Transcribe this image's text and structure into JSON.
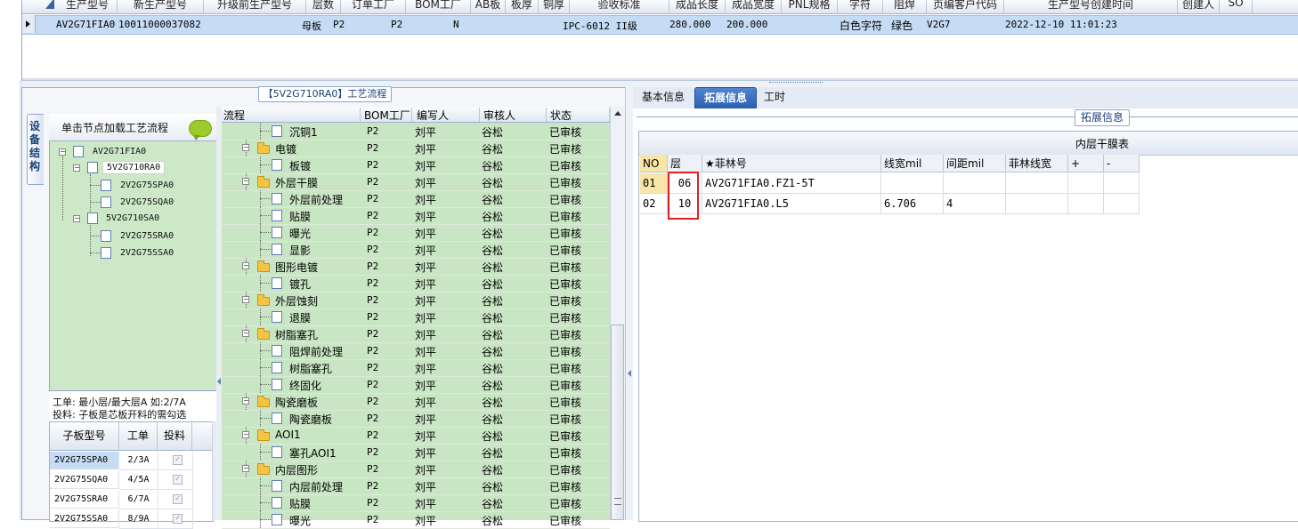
{
  "top_grid": {
    "headers": [
      "生产型号",
      "新生产型号",
      "升级前生产型号",
      "层数",
      "订单工厂",
      "BOM工厂",
      "AB板",
      "板厚",
      "铜厚",
      "验收标准",
      "成品长度",
      "成品宽度",
      "PNL规格",
      "字符",
      "阻焊",
      "页编客户代码",
      "生产型号创建时间",
      "创建人",
      "SO"
    ],
    "row": {
      "model": "AV2G71FIA0",
      "new_model": "10011000037082",
      "board_type": "母板",
      "order_factory": "P2",
      "bom_factory": "P2",
      "ab": "N",
      "standard": "IPC-6012 II级",
      "length": "280.000",
      "width": "200.000",
      "char": "白色字符",
      "solder": "绿色",
      "code": "V2G7",
      "created": "2022-12-10 11:01:23"
    }
  },
  "left_panel": {
    "title": "【5V2G710RA0】工艺流程",
    "vertical_tab": "设备结构",
    "tree_header": "单击节点加载工艺流程",
    "tree": [
      {
        "label": "AV2G71FIA0",
        "level": 0
      },
      {
        "label": "5V2G710RA0",
        "level": 1
      },
      {
        "label": "2V2G75SPA0",
        "level": 2
      },
      {
        "label": "2V2G75SQA0",
        "level": 2
      },
      {
        "label": "5V2G710SA0",
        "level": 1
      },
      {
        "label": "2V2G75SRA0",
        "level": 2
      },
      {
        "label": "2V2G75SSA0",
        "level": 2
      }
    ],
    "note_line1": "工单: 最小层/最大层A 如:2/7A",
    "note_line2": "投料: 子板是芯板开料的需勾选",
    "subgrid_headers": [
      "子板型号",
      "工单",
      "投料"
    ],
    "subgrid_rows": [
      {
        "model": "2V2G75SPA0",
        "order": "2/3A"
      },
      {
        "model": "2V2G75SQA0",
        "order": "4/5A"
      },
      {
        "model": "2V2G75SRA0",
        "order": "6/7A"
      },
      {
        "model": "2V2G75SSA0",
        "order": "8/9A"
      }
    ]
  },
  "flow_grid": {
    "headers": [
      "流程",
      "BOM工厂",
      "编写人",
      "审核人",
      "状态"
    ],
    "rows": [
      {
        "name": "沉铜1",
        "type": "doc",
        "factory": "P2",
        "writer": "刘平",
        "reviewer": "谷松",
        "status": "已审核"
      },
      {
        "name": "电镀",
        "type": "folder",
        "factory": "P2",
        "writer": "刘平",
        "reviewer": "谷松",
        "status": "已审核"
      },
      {
        "name": "板镀",
        "type": "doc",
        "factory": "P2",
        "writer": "刘平",
        "reviewer": "谷松",
        "status": "已审核"
      },
      {
        "name": "外层干膜",
        "type": "folder",
        "factory": "P2",
        "writer": "刘平",
        "reviewer": "谷松",
        "status": "已审核"
      },
      {
        "name": "外层前处理",
        "type": "doc",
        "factory": "P2",
        "writer": "刘平",
        "reviewer": "谷松",
        "status": "已审核"
      },
      {
        "name": "贴膜",
        "type": "doc",
        "factory": "P2",
        "writer": "刘平",
        "reviewer": "谷松",
        "status": "已审核"
      },
      {
        "name": "曝光",
        "type": "doc",
        "factory": "P2",
        "writer": "刘平",
        "reviewer": "谷松",
        "status": "已审核"
      },
      {
        "name": "显影",
        "type": "doc",
        "factory": "P2",
        "writer": "刘平",
        "reviewer": "谷松",
        "status": "已审核"
      },
      {
        "name": "图形电镀",
        "type": "folder",
        "factory": "P2",
        "writer": "刘平",
        "reviewer": "谷松",
        "status": "已审核"
      },
      {
        "name": "镀孔",
        "type": "doc",
        "factory": "P2",
        "writer": "刘平",
        "reviewer": "谷松",
        "status": "已审核"
      },
      {
        "name": "外层蚀刻",
        "type": "folder",
        "factory": "P2",
        "writer": "刘平",
        "reviewer": "谷松",
        "status": "已审核"
      },
      {
        "name": "退膜",
        "type": "doc",
        "factory": "P2",
        "writer": "刘平",
        "reviewer": "谷松",
        "status": "已审核"
      },
      {
        "name": "树脂塞孔",
        "type": "folder",
        "factory": "P2",
        "writer": "刘平",
        "reviewer": "谷松",
        "status": "已审核"
      },
      {
        "name": "阻焊前处理",
        "type": "doc",
        "factory": "P2",
        "writer": "刘平",
        "reviewer": "谷松",
        "status": "已审核"
      },
      {
        "name": "树脂塞孔",
        "type": "doc",
        "factory": "P2",
        "writer": "刘平",
        "reviewer": "谷松",
        "status": "已审核"
      },
      {
        "name": "终固化",
        "type": "doc",
        "factory": "P2",
        "writer": "刘平",
        "reviewer": "谷松",
        "status": "已审核"
      },
      {
        "name": "陶瓷磨板",
        "type": "folder",
        "factory": "P2",
        "writer": "刘平",
        "reviewer": "谷松",
        "status": "已审核"
      },
      {
        "name": "陶瓷磨板",
        "type": "doc",
        "factory": "P2",
        "writer": "刘平",
        "reviewer": "谷松",
        "status": "已审核"
      },
      {
        "name": "AOI1",
        "type": "folder",
        "factory": "P2",
        "writer": "刘平",
        "reviewer": "谷松",
        "status": "已审核"
      },
      {
        "name": "塞孔AOI1",
        "type": "doc",
        "factory": "P2",
        "writer": "刘平",
        "reviewer": "谷松",
        "status": "已审核"
      },
      {
        "name": "内层图形",
        "type": "folder",
        "factory": "P2",
        "writer": "刘平",
        "reviewer": "谷松",
        "status": "已审核"
      },
      {
        "name": "内层前处理",
        "type": "doc",
        "factory": "P2",
        "writer": "刘平",
        "reviewer": "谷松",
        "status": "已审核"
      },
      {
        "name": "贴膜",
        "type": "doc",
        "factory": "P2",
        "writer": "刘平",
        "reviewer": "谷松",
        "status": "已审核"
      },
      {
        "name": "曝光",
        "type": "doc",
        "factory": "P2",
        "writer": "刘平",
        "reviewer": "谷松",
        "status": "已审核"
      }
    ]
  },
  "right_panel": {
    "tabs": [
      "基本信息",
      "拓展信息",
      "工时"
    ],
    "active_tab": "拓展信息",
    "section_label": "拓展信息",
    "table_title": "内层干膜表",
    "headers": [
      "NO",
      "层",
      "★菲林号",
      "线宽mil",
      "间距mil",
      "菲林线宽",
      "+",
      "-"
    ],
    "rows": [
      {
        "no": "01",
        "layer": "06",
        "film": "AV2G71FIA0.FZ1-5T",
        "width": "",
        "spacing": "",
        "film_width": ""
      },
      {
        "no": "02",
        "layer": "10",
        "film": "AV2G71FIA0.L5",
        "width": "6.706",
        "spacing": "4",
        "film_width": ""
      }
    ]
  },
  "colors": {
    "tree_bg": "#cce8c7",
    "active_tab": "#2b5fb0",
    "highlight_box": "#e02020",
    "selected_row": "#c6dcf4"
  }
}
